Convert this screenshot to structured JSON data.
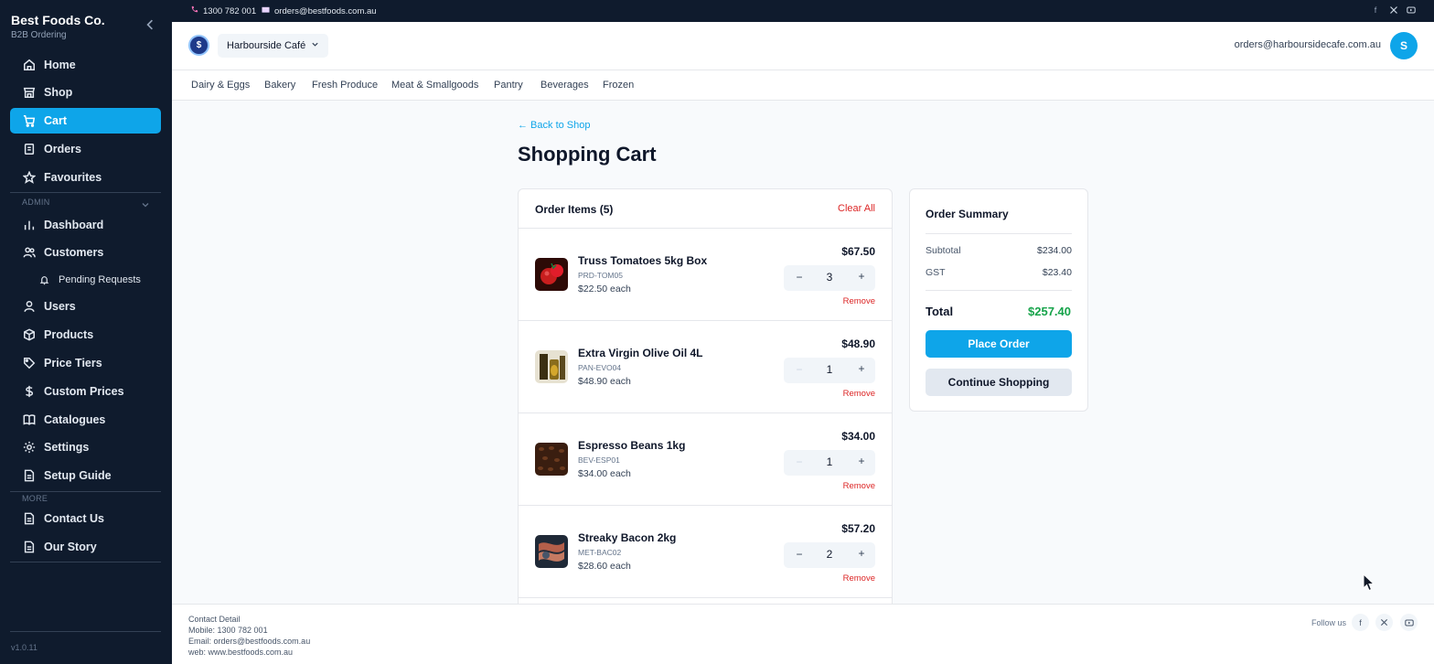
{
  "brand": {
    "name": "Best Foods Co.",
    "subtitle": "B2B Ordering"
  },
  "sidebar": {
    "main_items": [
      {
        "label": "Home",
        "icon": "home-icon"
      },
      {
        "label": "Shop",
        "icon": "store-icon"
      },
      {
        "label": "Cart",
        "icon": "cart-icon",
        "active": true
      },
      {
        "label": "Orders",
        "icon": "orders-icon"
      },
      {
        "label": "Favourites",
        "icon": "star-icon"
      }
    ],
    "admin_label": "ADMIN",
    "admin_items": [
      {
        "label": "Dashboard",
        "icon": "bar-chart-icon"
      },
      {
        "label": "Customers",
        "icon": "users-icon"
      },
      {
        "label": "Pending Requests",
        "icon": "bell-icon"
      },
      {
        "label": "Users",
        "icon": "user-icon"
      },
      {
        "label": "Products",
        "icon": "box-icon"
      },
      {
        "label": "Price Tiers",
        "icon": "tag-icon"
      },
      {
        "label": "Custom Prices",
        "icon": "dollar-icon"
      },
      {
        "label": "Catalogues",
        "icon": "book-icon"
      },
      {
        "label": "Settings",
        "icon": "gear-icon"
      },
      {
        "label": "Setup Guide",
        "icon": "document-icon"
      }
    ],
    "more_label": "MORE",
    "more_items": [
      {
        "label": "Contact Us",
        "icon": "document-icon"
      },
      {
        "label": "Our Story",
        "icon": "document-icon"
      }
    ],
    "version": "v1.0.11"
  },
  "topbar": {
    "phone": "1300 782 001",
    "email": "orders@bestfoods.com.au"
  },
  "header": {
    "store_name": "Harbourside Café",
    "user_email": "orders@harboursidecafe.com.au",
    "avatar_initial": "S"
  },
  "categories": [
    "Dairy & Eggs",
    "Bakery",
    "Fresh Produce",
    "Meat & Smallgoods",
    "Pantry",
    "Beverages",
    "Frozen"
  ],
  "main": {
    "back_link": "← Back to Shop",
    "title": "Shopping Cart",
    "items_title": "Order Items (5)",
    "clear_all": "Clear All",
    "remove_label": "Remove",
    "items": [
      {
        "name": "Truss Tomatoes 5kg Box",
        "sku": "PRD-TOM05",
        "each": "$22.50 each",
        "qty": "3",
        "total": "$67.50",
        "minus": "−",
        "plus": "+"
      },
      {
        "name": "Extra Virgin Olive Oil 4L",
        "sku": "PAN-EVO04",
        "each": "$48.90 each",
        "qty": "1",
        "total": "$48.90",
        "minus": "−",
        "plus": "+"
      },
      {
        "name": "Espresso Beans 1kg",
        "sku": "BEV-ESP01",
        "each": "$34.00 each",
        "qty": "1",
        "total": "$34.00",
        "minus": "−",
        "plus": "+"
      },
      {
        "name": "Streaky Bacon 2kg",
        "sku": "MET-BAC02",
        "each": "$28.60 each",
        "qty": "2",
        "total": "$57.20",
        "minus": "−",
        "plus": "+"
      }
    ]
  },
  "summary": {
    "title": "Order Summary",
    "subtotal_label": "Subtotal",
    "subtotal": "$234.00",
    "gst_label": "GST",
    "gst": "$23.40",
    "total_label": "Total",
    "total": "$257.40",
    "place_order": "Place Order",
    "continue_shopping": "Continue Shopping"
  },
  "footer": {
    "heading": "Contact Detail",
    "mobile": "Mobile: 1300 782 001",
    "email": "Email: orders@bestfoods.com.au",
    "web": "web: www.bestfoods.com.au",
    "follow": "Follow us"
  },
  "colors": {
    "sidebar_bg": "#0f1b2d",
    "accent": "#0ea5e9",
    "danger": "#dc2626",
    "success": "#16a34a"
  }
}
